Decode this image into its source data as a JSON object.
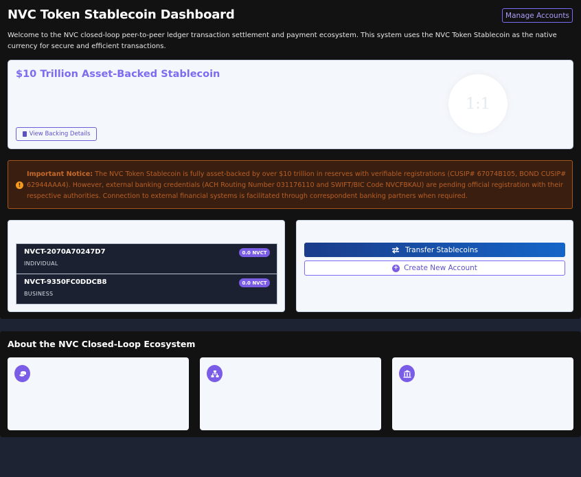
{
  "header": {
    "title": "NVC Token Stablecoin Dashboard",
    "manage_accounts_label": "Manage Accounts",
    "welcome_text": "Welcome to the NVC closed-loop peer-to-peer ledger transaction settlement and payment ecosystem. This system uses the NVC Token Stablecoin as the native currency for secure and efficient transactions."
  },
  "stablecoin_card": {
    "title": "$10 Trillion Asset-Backed Stablecoin",
    "ratio": "1:1",
    "backing_button_label": "View Backing Details"
  },
  "notice": {
    "label": "Important Notice:",
    "text": " The NVC Token Stablecoin is fully asset-backed by over $10 trillion in reserves with verifiable registrations (CUSIP# 67074B105, BOND CUSIP# 62944AAA4). However, external banking credentials (ACH Routing Number 031176110 and SWIFT/BIC Code NVCFBKAU) are pending official registration with their respective authorities. Connection to external financial systems is facilitated through correspondent banking partners when required."
  },
  "accounts": [
    {
      "id": "NVCT-2070A70247D7",
      "type": "INDIVIDUAL",
      "balance": "0.0 NVCT"
    },
    {
      "id": "NVCT-9350FC0DDCB8",
      "type": "BUSINESS",
      "balance": "0.0 NVCT"
    }
  ],
  "actions": {
    "transfer_label": "Transfer Stablecoins",
    "create_label": "Create New Account"
  },
  "about": {
    "title": "About the NVC Closed-Loop Ecosystem",
    "feature_icons": [
      "coins-icon",
      "network-icon",
      "bank-icon"
    ]
  },
  "colors": {
    "accent": "#7b5ce6",
    "notice_text": "#b85f27",
    "transfer_gradient_start": "#1a3c8a",
    "transfer_gradient_end": "#1565c8"
  }
}
